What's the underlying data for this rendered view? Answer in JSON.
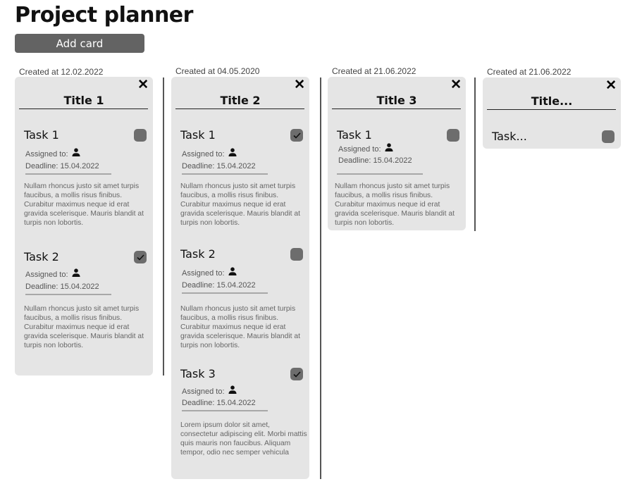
{
  "page": {
    "title": "Project planner",
    "add_card_label": "Add card",
    "close_glyph": "✕"
  },
  "cards": [
    {
      "created": "Created at 12.02.2022",
      "title": "Title 1",
      "tasks": [
        {
          "name": "Task 1",
          "checked": false,
          "assigned_label": "Assigned to:",
          "deadline": "Deadline: 15.04.2022",
          "description": "Nullam rhoncus justo sit amet turpis faucibus, a mollis risus finibus. Curabitur maximus neque id erat gravida scelerisque. Mauris blandit at turpis non lobortis."
        },
        {
          "name": "Task 2",
          "checked": true,
          "assigned_label": "Assigned to:",
          "deadline": "Deadline: 15.04.2022",
          "description": "Nullam rhoncus justo sit amet turpis faucibus, a mollis risus finibus. Curabitur maximus neque id erat gravida scelerisque. Mauris blandit at turpis non lobortis."
        }
      ]
    },
    {
      "created": "Created at 04.05.2020",
      "title": "Title 2",
      "tasks": [
        {
          "name": "Task 1",
          "checked": true,
          "assigned_label": "Assigned to:",
          "deadline": "Deadline: 15.04.2022",
          "description": "Nullam rhoncus justo sit amet turpis faucibus, a mollis risus finibus. Curabitur maximus neque id erat gravida scelerisque. Mauris blandit at turpis non lobortis."
        },
        {
          "name": "Task 2",
          "checked": false,
          "assigned_label": "Assigned to:",
          "deadline": "Deadline: 15.04.2022",
          "description": "Nullam rhoncus justo sit amet turpis faucibus, a mollis risus finibus. Curabitur maximus neque id erat gravida scelerisque. Mauris blandit at turpis non lobortis."
        },
        {
          "name": "Task 3",
          "checked": true,
          "assigned_label": "Assigned to:",
          "deadline": "Deadline: 15.04.2022",
          "description": "Lorem ipsum dolor sit amet, consectetur adipiscing elit. Morbi mattis quis mauris non faucibus. Aliquam tempor, odio nec semper vehicula"
        }
      ]
    },
    {
      "created": "Created at 21.06.2022",
      "title": "Title 3",
      "tasks": [
        {
          "name": "Task 1",
          "checked": false,
          "assigned_label": "Assigned to:",
          "deadline": "Deadline: 15.04.2022",
          "description": "Nullam rhoncus justo sit amet turpis faucibus, a mollis risus finibus. Curabitur maximus neque id erat gravida scelerisque. Mauris blandit at turpis non lobortis."
        }
      ]
    },
    {
      "created": "Created at 21.06.2022",
      "title": "Title...",
      "tasks": [
        {
          "name": "Task...",
          "checked": false
        }
      ]
    }
  ]
}
